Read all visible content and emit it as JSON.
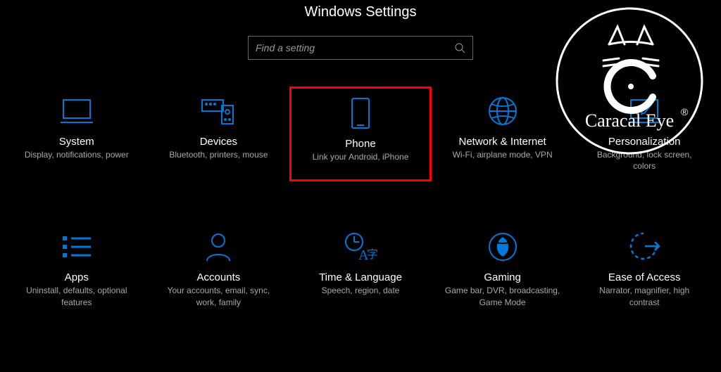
{
  "page": {
    "title": "Windows Settings",
    "search_placeholder": "Find a setting"
  },
  "tiles": [
    {
      "id": "system",
      "title": "System",
      "desc": "Display, notifications, power",
      "highlighted": false
    },
    {
      "id": "devices",
      "title": "Devices",
      "desc": "Bluetooth, printers, mouse",
      "highlighted": false
    },
    {
      "id": "phone",
      "title": "Phone",
      "desc": "Link your Android, iPhone",
      "highlighted": true
    },
    {
      "id": "network",
      "title": "Network & Internet",
      "desc": "Wi-Fi, airplane mode, VPN",
      "highlighted": false
    },
    {
      "id": "personalization",
      "title": "Personalization",
      "desc": "Background, lock screen, colors",
      "highlighted": false
    },
    {
      "id": "apps",
      "title": "Apps",
      "desc": "Uninstall, defaults, optional features",
      "highlighted": false
    },
    {
      "id": "accounts",
      "title": "Accounts",
      "desc": "Your accounts, email, sync, work, family",
      "highlighted": false
    },
    {
      "id": "time",
      "title": "Time & Language",
      "desc": "Speech, region, date",
      "highlighted": false
    },
    {
      "id": "gaming",
      "title": "Gaming",
      "desc": "Game bar, DVR, broadcasting, Game Mode",
      "highlighted": false
    },
    {
      "id": "ease",
      "title": "Ease of Access",
      "desc": "Narrator, magnifier, high contrast",
      "highlighted": false
    }
  ],
  "watermark": {
    "brand": "Caracal Eye",
    "registered": "®"
  },
  "colors": {
    "accent": "#0078d7",
    "highlight_border": "#ff0000",
    "background": "#000000",
    "text_primary": "#ffffff",
    "text_secondary": "#a8a8a8"
  }
}
